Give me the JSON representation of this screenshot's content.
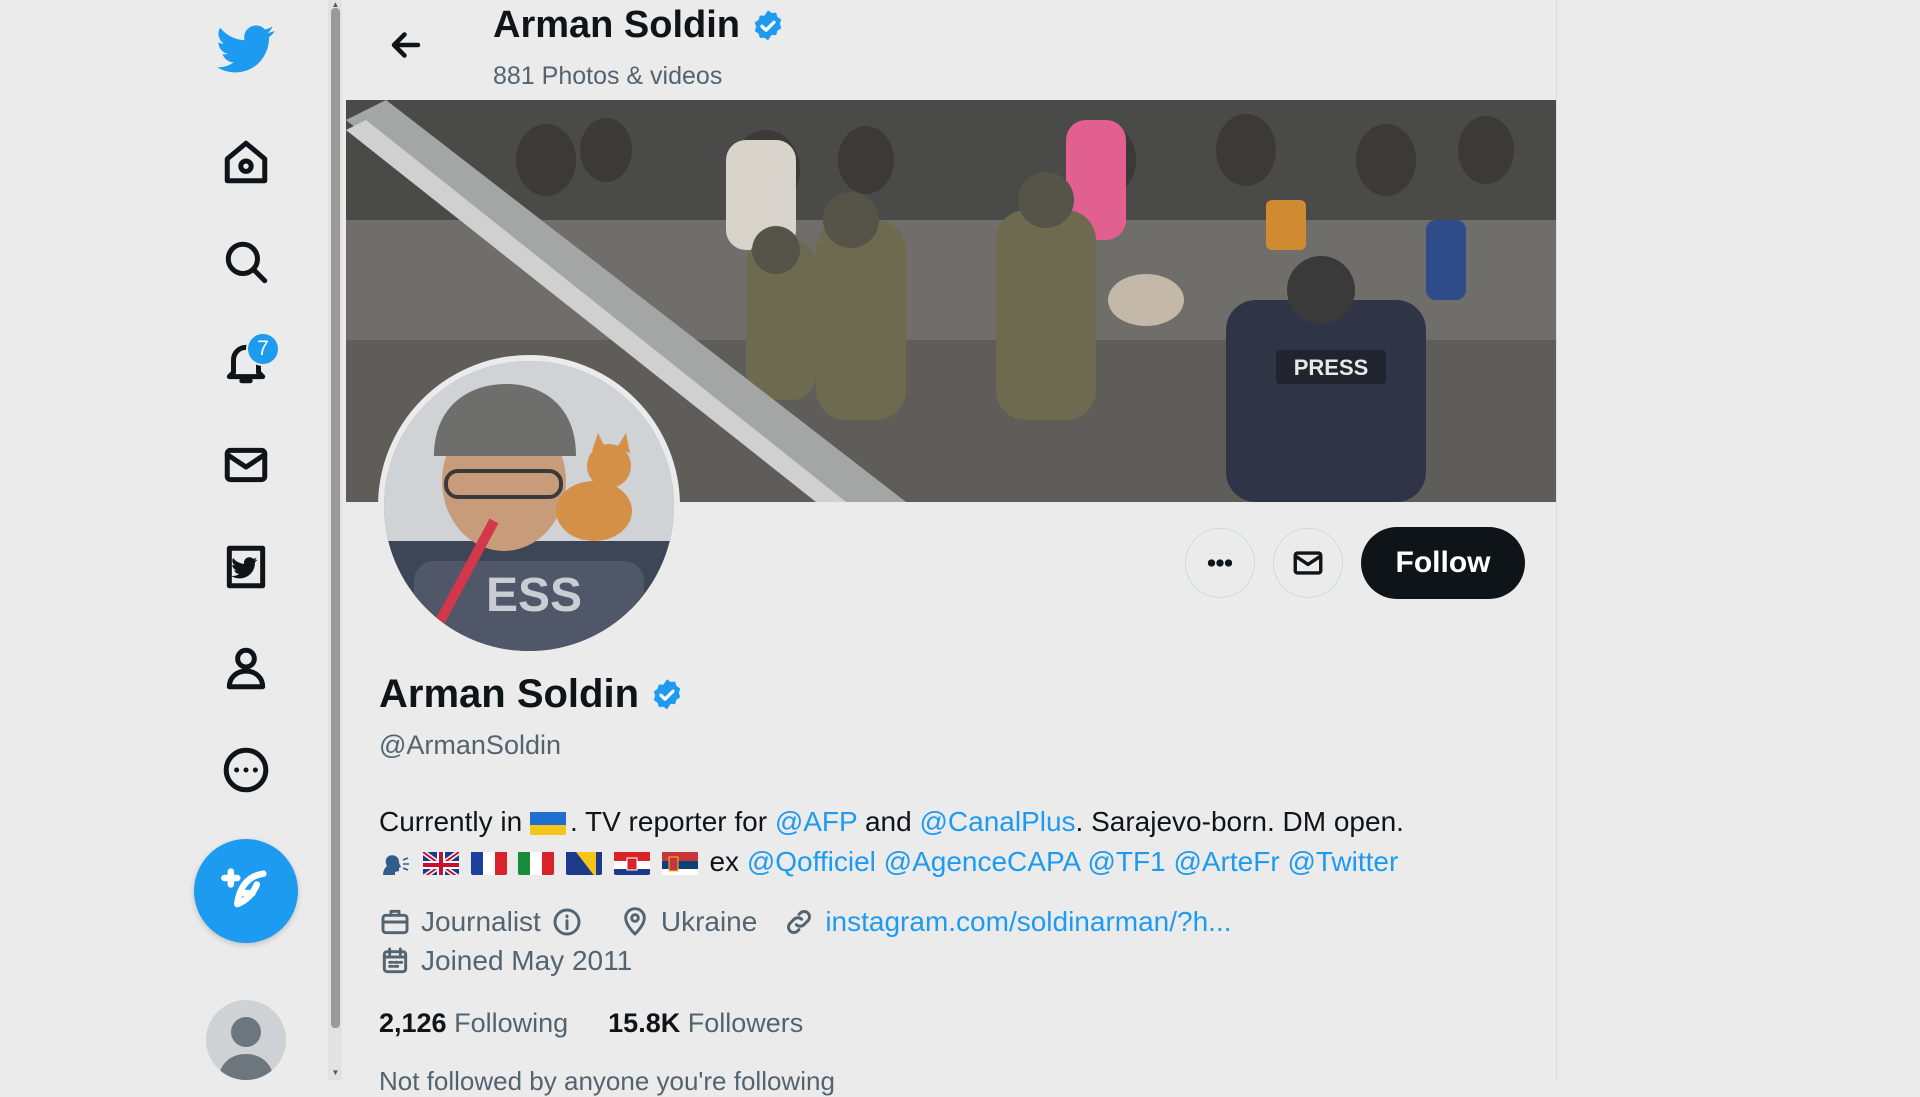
{
  "colors": {
    "accent": "#1d9bf0",
    "text": "#0f1419",
    "muted": "#536471",
    "background": "#ebebeb"
  },
  "sidebar": {
    "items": [
      {
        "name": "twitter-logo",
        "icon": "bird-icon"
      },
      {
        "name": "home",
        "icon": "home-icon"
      },
      {
        "name": "explore",
        "icon": "search-icon"
      },
      {
        "name": "notifications",
        "icon": "bell-icon",
        "badge": "7"
      },
      {
        "name": "messages",
        "icon": "envelope-icon"
      },
      {
        "name": "twitter-blue",
        "icon": "twitter-square-icon"
      },
      {
        "name": "profile",
        "icon": "person-icon"
      },
      {
        "name": "more",
        "icon": "more-circle-icon"
      }
    ],
    "compose_icon": "feather-plus-icon",
    "account_avatar": "avatar-placeholder"
  },
  "header": {
    "title": "Arman Soldin",
    "subtitle": "881 Photos & videos",
    "back_icon": "arrow-left-icon"
  },
  "profile": {
    "name": "Arman Soldin",
    "handle": "@ArmanSoldin",
    "bio_line1": {
      "t1": "Currently in ",
      "t2": ". TV reporter for ",
      "mention1": "@AFP",
      "t3": " and ",
      "mention2": "@CanalPlus",
      "t4": ". Sarajevo-born. DM open."
    },
    "bio_line2": {
      "t1": "ex ",
      "mentions": [
        "@Qofficiel",
        "@AgenceCAPA",
        "@TF1",
        "@ArteFr",
        "@Twitter"
      ]
    },
    "category": "Journalist",
    "location": "Ukraine",
    "website": "instagram.com/soldinarman/?h...",
    "joined": "Joined May 2011",
    "following_count": "2,126",
    "following_label": "Following",
    "followers_count": "15.8K",
    "followers_label": "Followers",
    "followed_by_partial": "Not followed by anyone you're following"
  },
  "actions": {
    "more_icon": "more-horizontal-icon",
    "message_icon": "envelope-icon",
    "follow_label": "Follow"
  }
}
